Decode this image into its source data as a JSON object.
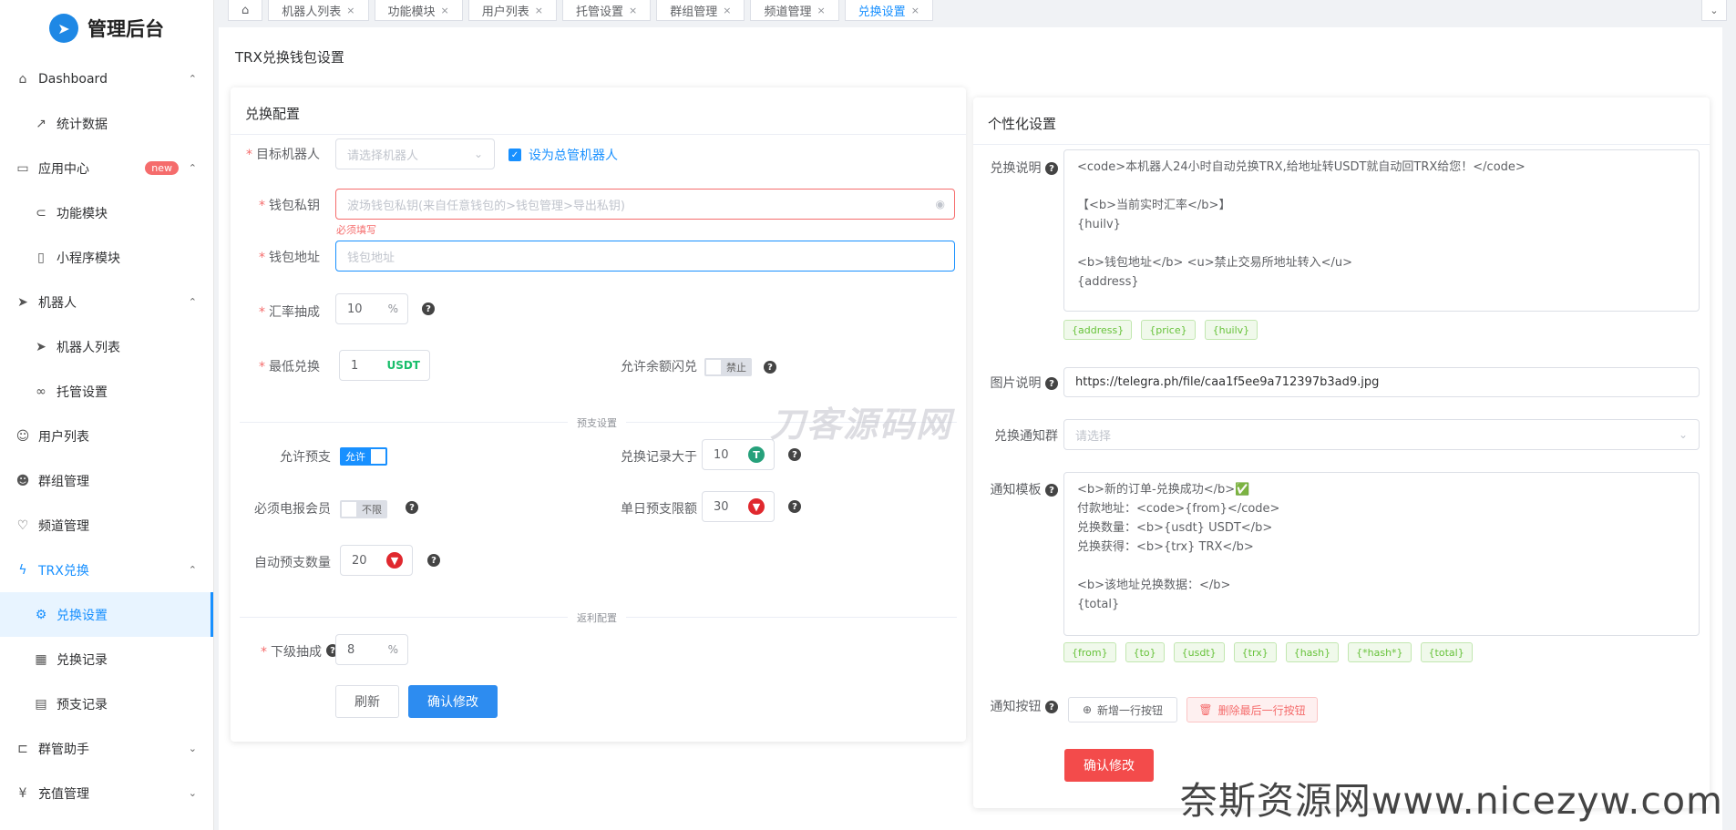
{
  "brand": {
    "title": "管理后台"
  },
  "sidebar": {
    "items": [
      {
        "label": "Dashboard",
        "icon": "home-icon",
        "arrow": "⌃"
      },
      {
        "label": "统计数据",
        "icon": "trend-icon"
      },
      {
        "label": "应用中心",
        "icon": "app-icon",
        "badge": "new",
        "arrow": "⌃"
      },
      {
        "label": "功能模块",
        "icon": "toggle-icon"
      },
      {
        "label": "小程序模块",
        "icon": "phone-icon"
      },
      {
        "label": "机器人",
        "icon": "send-icon",
        "arrow": "⌃"
      },
      {
        "label": "机器人列表",
        "icon": "send-icon"
      },
      {
        "label": "托管设置",
        "icon": "link-icon"
      },
      {
        "label": "用户列表",
        "icon": "user-icon"
      },
      {
        "label": "群组管理",
        "icon": "users-icon"
      },
      {
        "label": "频道管理",
        "icon": "heart-icon"
      },
      {
        "label": "TRX兑换",
        "icon": "flash-icon",
        "arrow": "⌃"
      },
      {
        "label": "兑换设置",
        "icon": "gear-icon"
      },
      {
        "label": "兑换记录",
        "icon": "grid-icon"
      },
      {
        "label": "预支记录",
        "icon": "doc-icon"
      },
      {
        "label": "群管助手",
        "icon": "tool-icon",
        "arrow": "⌄"
      },
      {
        "label": "充值管理",
        "icon": "yen-icon",
        "arrow": "⌄"
      }
    ]
  },
  "tabs": [
    {
      "label": "⌂"
    },
    {
      "label": "机器人列表",
      "close": "×"
    },
    {
      "label": "功能模块",
      "close": "×"
    },
    {
      "label": "用户列表",
      "close": "×"
    },
    {
      "label": "托管设置",
      "close": "×"
    },
    {
      "label": "群组管理",
      "close": "×"
    },
    {
      "label": "频道管理",
      "close": "×"
    },
    {
      "label": "兑换设置",
      "close": "×"
    }
  ],
  "tab_right": "⌄",
  "page_title": "TRX兑换钱包设置",
  "exchange": {
    "title": "兑换配置",
    "target_bot_label": "目标机器人",
    "target_bot_placeholder": "请选择机器人",
    "set_master_label": "设为总管机器人",
    "wallet_key_label": "钱包私钥",
    "wallet_key_placeholder": "波场钱包私钥(来自任意钱包的>钱包管理>导出私钥)",
    "wallet_key_error": "必须填写",
    "wallet_addr_label": "钱包地址",
    "wallet_addr_placeholder": "钱包地址",
    "rate_label": "汇率抽成",
    "rate_value": "10",
    "rate_suffix": "%",
    "min_label": "最低兑换",
    "min_value": "1",
    "min_suffix": "USDT",
    "flash_label": "允许余额闪兑",
    "flash_state": "禁止",
    "advance_divider": "预支设置",
    "allow_advance_label": "允许预支",
    "allow_advance_state": "允许",
    "records_gt_label": "兑换记录大于",
    "records_gt_value": "10",
    "must_tg_label": "必须电报会员",
    "must_tg_state": "不限",
    "daily_limit_label": "单日预支限额",
    "daily_limit_value": "30",
    "auto_qty_label": "自动预支数量",
    "auto_qty_value": "20",
    "rebate_divider": "返利配置",
    "sub_rate_label": "下级抽成",
    "sub_rate_value": "8",
    "sub_rate_suffix": "%",
    "refresh_label": "刷新",
    "confirm_label": "确认修改"
  },
  "custom": {
    "title": "个性化设置",
    "desc_label": "兑换说明",
    "desc_lines": [
      "<code>本机器人24小时自动兑换TRX,给地址转USDT就自动回TRX给您！</code>",
      "",
      "【<b>当前实时汇率</b>】",
      "{huilv}",
      "",
      "<b>钱包地址</b> <u>禁止交易所地址转入</u>",
      "{address}"
    ],
    "desc_tags": [
      "{address}",
      "{price}",
      "{huilv}"
    ],
    "img_label": "图片说明",
    "img_value": "https://telegra.ph/file/caa1f5ee9a712397b3ad9.jpg",
    "group_label": "兑换通知群",
    "group_placeholder": "请选择",
    "tpl_label": "通知模板",
    "tpl_lines": [
      "<b>新的订单-兑换成功</b>✅",
      "付款地址：<code>{from}</code>",
      "兑换数量：<b>{usdt} USDT</b>",
      "兑换获得：<b>{trx} TRX</b>",
      "",
      "<b>该地址兑换数据：</b>",
      "{total}"
    ],
    "tpl_tags": [
      "{from}",
      "{to}",
      "{usdt}",
      "{trx}",
      "{hash}",
      "{*hash*}",
      "{total}"
    ],
    "btn_label": "通知按钮",
    "add_row_label": "新增一行按钮",
    "del_row_label": "删除最后一行按钮",
    "confirm_label": "确认修改"
  },
  "watermarks": {
    "center": "刀客源码网",
    "bottom": "奈斯资源网www.nicezyw.com"
  },
  "colors": {
    "accent": "#1890ff",
    "primary_btn": "#2d8cf0",
    "danger_btn": "#f34b4b",
    "error": "#f56c6c",
    "tag_green": "#67c23a"
  }
}
